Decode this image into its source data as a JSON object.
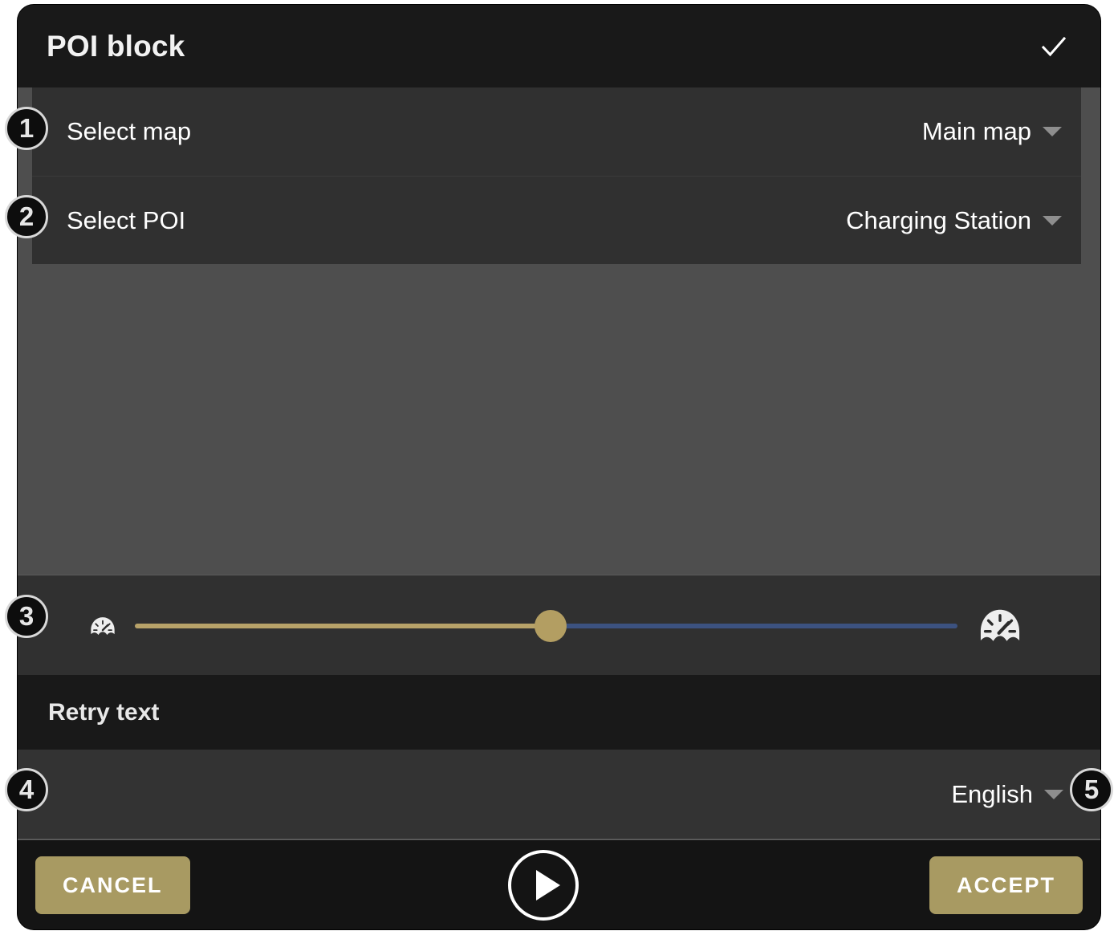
{
  "header": {
    "title": "POI block",
    "confirm_icon": "check-icon"
  },
  "rows": [
    {
      "label": "Select map",
      "value": "Main map",
      "caret_icon": "chevron-down-icon"
    },
    {
      "label": "Select POI",
      "value": "Charging Station",
      "caret_icon": "chevron-down-icon"
    }
  ],
  "slider": {
    "left_icon": "gauge-slow-icon",
    "right_icon": "gauge-fast-icon",
    "value_percent": 50,
    "fill_color": "#b7a269",
    "remainder_color": "#3c5280",
    "thumb_color": "#b39e62"
  },
  "retry": {
    "label": "Retry text"
  },
  "language": {
    "value": "English",
    "caret_icon": "chevron-down-icon"
  },
  "footer": {
    "cancel_label": "CANCEL",
    "play_icon": "play-circle-icon",
    "accept_label": "ACCEPT",
    "accent_color": "#a89a62"
  },
  "annotations": [
    {
      "number": "1"
    },
    {
      "number": "2"
    },
    {
      "number": "3"
    },
    {
      "number": "4"
    },
    {
      "number": "5"
    }
  ]
}
